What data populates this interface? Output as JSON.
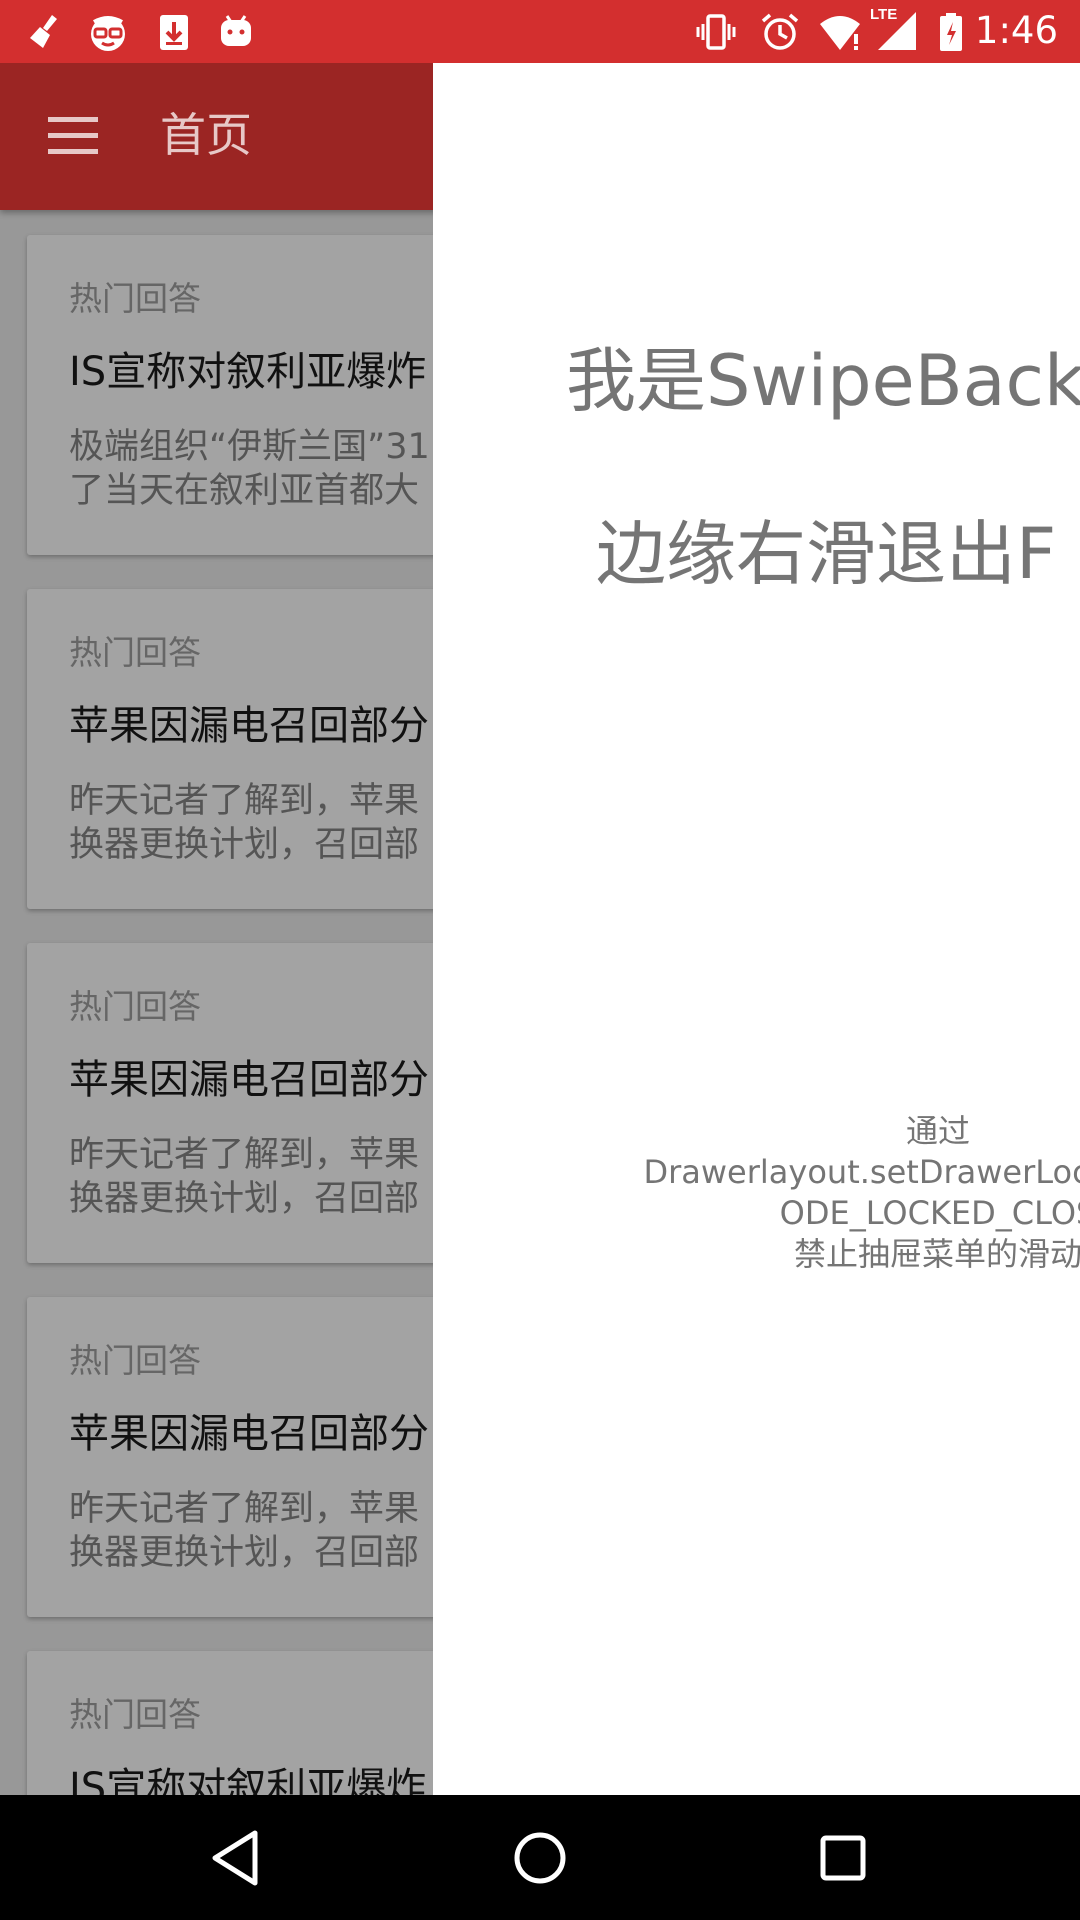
{
  "status_bar": {
    "time": "1:46",
    "left_icons": [
      "broom-icon",
      "glasses-icon",
      "download-icon",
      "android-icon"
    ],
    "right_icons": [
      "vibrate-icon",
      "alarm-icon",
      "wifi-icon",
      "lte-signal-icon",
      "battery-icon"
    ],
    "lte_label": "LTE"
  },
  "app_bar": {
    "title": "首页",
    "menu_icon": "menu-icon"
  },
  "feed": {
    "cards": [
      {
        "tag": "热门回答",
        "title": "IS宣称对叙利亚爆炸",
        "excerpt_line1": "极端组织“伊斯兰国”31",
        "excerpt_line2": "了当天在叙利亚首都大"
      },
      {
        "tag": "热门回答",
        "title": "苹果因漏电召回部分",
        "excerpt_line1": "昨天记者了解到，苹果",
        "excerpt_line2": "换器更换计划，召回部"
      },
      {
        "tag": "热门回答",
        "title": "苹果因漏电召回部分",
        "excerpt_line1": "昨天记者了解到，苹果",
        "excerpt_line2": "换器更换计划，召回部"
      },
      {
        "tag": "热门回答",
        "title": "苹果因漏电召回部分",
        "excerpt_line1": "昨天记者了解到，苹果",
        "excerpt_line2": "换器更换计划，召回部"
      },
      {
        "tag": "热门回答",
        "title": "IS宣称对叙利亚爆炸",
        "excerpt_line1": "",
        "excerpt_line2": ""
      }
    ]
  },
  "drawer": {
    "line1": "我是SwipeBackl",
    "line2": "边缘右滑退出F",
    "hint_line1": "通过",
    "hint_line2": "Drawerlayout.setDrawerLockMode(D",
    "hint_line3": "ODE_LOCKED_CLOS",
    "hint_line4": "禁止抽屉菜单的滑动"
  },
  "nav_bar": {
    "back": "back-triangle-icon",
    "home": "home-circle-icon",
    "recents": "recents-square-icon"
  },
  "colors": {
    "status_bar": "#d32f2f",
    "app_bar_dimmed": "#9b2523",
    "drawer_bg": "#ffffff",
    "nav_bar": "#000000"
  }
}
